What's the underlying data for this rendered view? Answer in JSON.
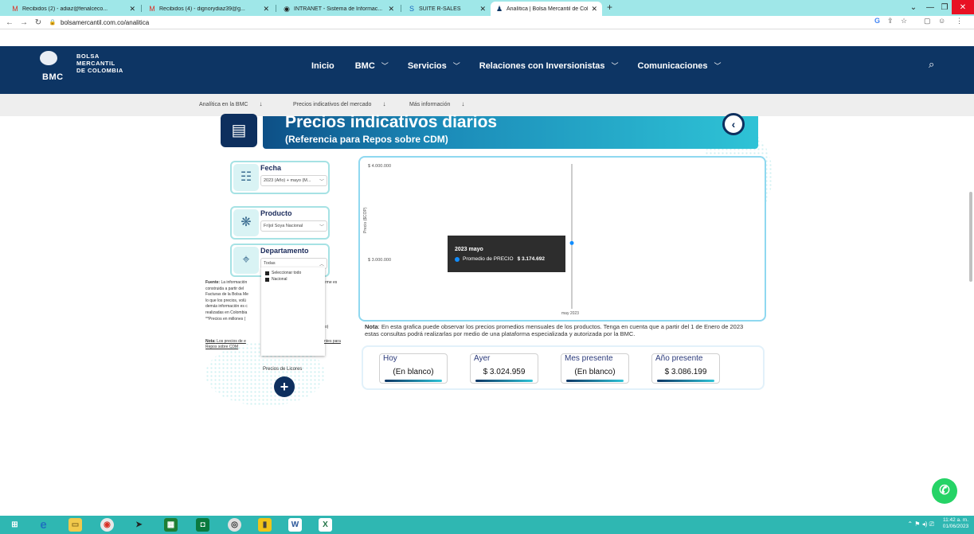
{
  "browser": {
    "tabs": [
      {
        "label": "Recibidos (2) - adiaz@fenalceco...",
        "icon": "gmail-icon"
      },
      {
        "label": "Recibidos (4) - dignorydiaz39@g...",
        "icon": "gmail-icon"
      },
      {
        "label": "INTRANET - Sistema de Informac...",
        "icon": "globe-icon"
      },
      {
        "label": "SUITE R-SALES",
        "icon": "suite-icon"
      },
      {
        "label": "Analítica | Bolsa Mercantil de Col...",
        "icon": "bmc-icon"
      }
    ],
    "url": "bolsamercantil.com.co/analitica"
  },
  "site": {
    "logo": {
      "short": "BMC",
      "line1": "BOLSA",
      "line2": "MERCANTIL",
      "line3": "DE COLOMBIA"
    },
    "nav": [
      {
        "label": "Inicio",
        "has_menu": false
      },
      {
        "label": "BMC",
        "has_menu": true
      },
      {
        "label": "Servicios",
        "has_menu": true
      },
      {
        "label": "Relaciones con Inversionistas",
        "has_menu": true
      },
      {
        "label": "Comunicaciones",
        "has_menu": true
      }
    ],
    "subnav": [
      "Analítica en la BMC",
      "Precios indicativos del mercado",
      "Más información"
    ]
  },
  "banner": {
    "title": "Precios indicativos diarios",
    "subtitle": "(Referencia para Repos sobre CDM)"
  },
  "filters": {
    "fecha": {
      "label": "Fecha",
      "value": "2023 (Año) + mayo (M..."
    },
    "producto": {
      "label": "Producto",
      "value": "Fríjol Soya Nacional"
    },
    "departamento": {
      "label": "Departamento",
      "value": "Todas",
      "options": [
        "Seleccionar todo",
        "Nacional"
      ]
    }
  },
  "left_text": {
    "fuente_label": "Fuente:",
    "fuente_lines": [
      " La información",
      "construida a partir del",
      "Facturas de la Bolsa Me",
      "lo que los precios, volú",
      "demás información es c",
      "realizadas en Colombia",
      "**Precios en millones ("
    ],
    "fuente_right_1": "rme es",
    "fuente_right_2": "o)",
    "nota_label": "Nota:",
    "nota_text": " Los precios de e",
    "nota_right": "ntes para",
    "nota_line2": "Repos sobre CDM",
    "licores_label": "Precios de Licores"
  },
  "chart_data": {
    "type": "line",
    "ylabel": "Precio ($COP)",
    "y_ticks": [
      "$ 4.000.000",
      "$ 3.000.000"
    ],
    "ylim": [
      3000000,
      4000000
    ],
    "categories": [
      "may 2023"
    ],
    "series": [
      {
        "name": "Promedio de PRECIO",
        "values": [
          3174692
        ]
      }
    ],
    "tooltip": {
      "title": "2023 mayo",
      "series": "Promedio de PRECIO",
      "value": "$ 3.174.692"
    }
  },
  "nota_right": {
    "label": "Nota",
    "text": ": En esta grafica puede observar los precios promedios mensuales de los productos. Tenga en cuenta que a partir del 1 de Enero de 2023 estas consultas podrá realizarlas por medio de una plataforma especializada y autorizada por la BMC."
  },
  "kpis": [
    {
      "label": "Hoy",
      "value": "(En blanco)"
    },
    {
      "label": "Ayer",
      "value": "$ 3.024.959"
    },
    {
      "label": "Mes presente",
      "value": "(En blanco)"
    },
    {
      "label": "Año presente",
      "value": "$ 3.086.199"
    }
  ],
  "taskbar": {
    "time": "11:42 a. m.",
    "date": "01/06/2023"
  }
}
